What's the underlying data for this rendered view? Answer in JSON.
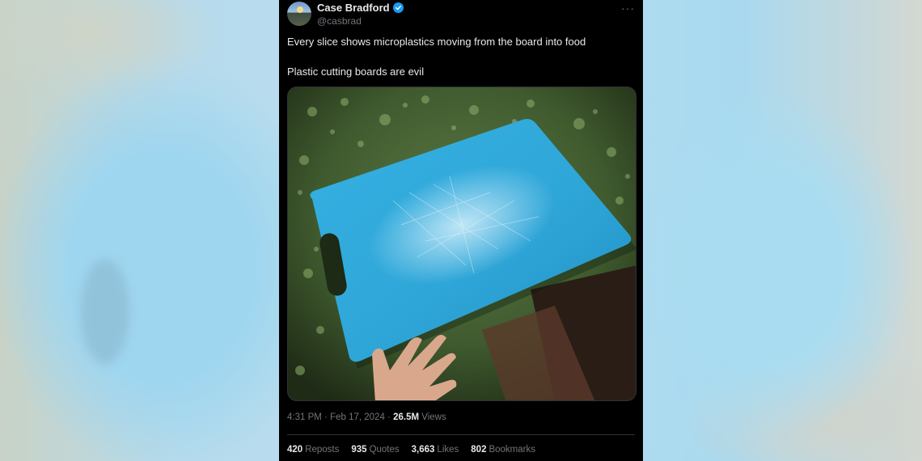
{
  "author": {
    "display_name": "Case Bradford",
    "handle": "@casbrad",
    "verified": true
  },
  "tweet": {
    "line1": "Every slice shows microplastics moving from the board into food",
    "line2": "Plastic cutting boards are evil",
    "more_icon": "···"
  },
  "meta": {
    "time": "4:31 PM",
    "sep1": " · ",
    "date": "Feb 17, 2024",
    "sep2": " · ",
    "views": "26.5M",
    "views_label": " Views"
  },
  "stats": {
    "reposts": "420",
    "reposts_label": "Reposts",
    "quotes": "935",
    "quotes_label": "Quotes",
    "likes": "3,663",
    "likes_label": "Likes",
    "bookmarks": "802",
    "bookmarks_label": "Bookmarks"
  },
  "colors": {
    "background": "#000000",
    "text": "#e7e9ea",
    "secondary": "#71767b",
    "verified": "#1d9bf0",
    "board": "#2ea7d9"
  },
  "media": {
    "description_icon": "photo-blue-cutting-board"
  }
}
